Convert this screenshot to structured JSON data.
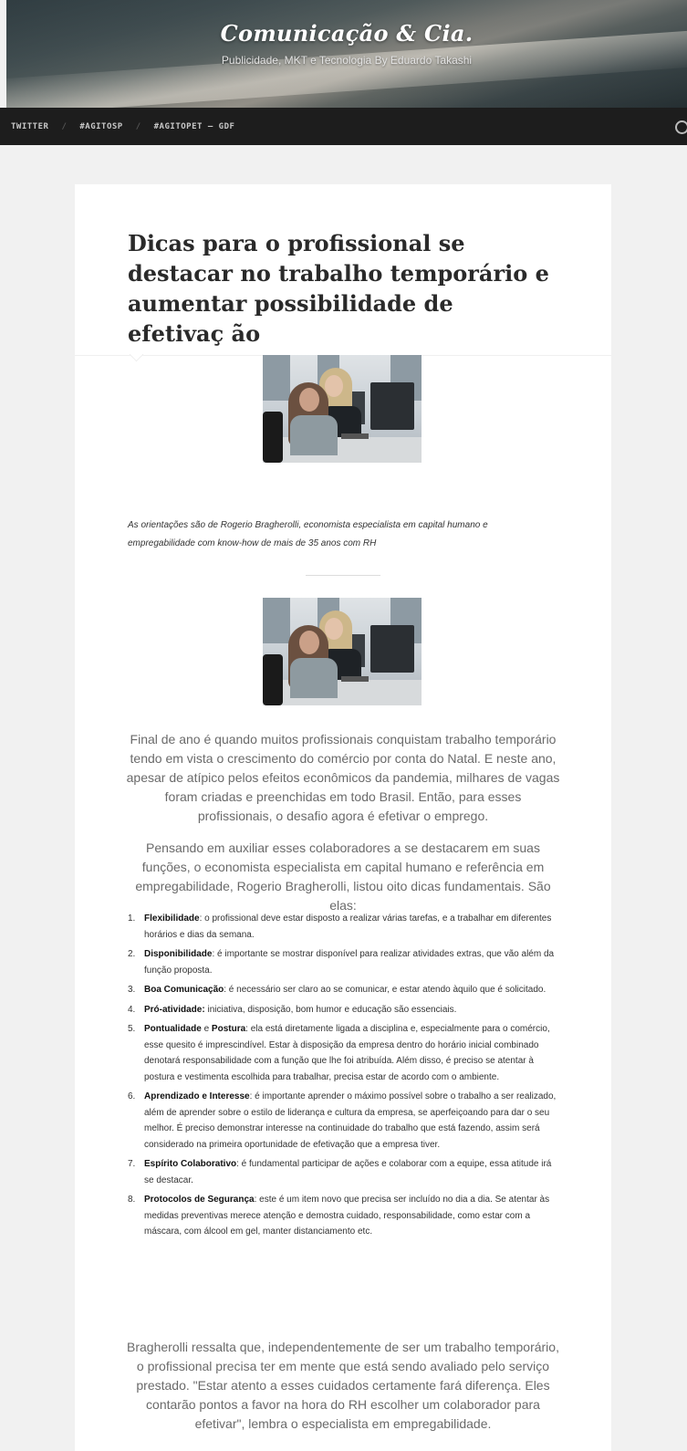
{
  "site": {
    "title": "Comunicação & Cia.",
    "description": "Publicidade, MKT e Tecnologia By Eduardo Takashi"
  },
  "nav": {
    "items": [
      "TWITTER",
      "#AGITOSP",
      "#AGITOPET – GDF"
    ],
    "separator": "/"
  },
  "post": {
    "title": "Dicas para o profissional se destacar no trabalho temporário e aumentar possibilidade de efetivaç ão",
    "caption": "As orientações são de Rogerio Bragherolli, economista especialista em capital humano e empregabilidade com know-how de mais de 35 anos com RH",
    "paragraph1": "Final de ano é quando muitos profissionais conquistam trabalho temporário tendo em vista o crescimento do comércio por conta do Natal. E neste ano, apesar de atípico pelos efeitos econômicos da pandemia, milhares de vagas foram criadas e preenchidas em todo Brasil. Então, para esses profissionais, o desafio agora é efetivar o emprego.",
    "paragraph2": "Pensando em auxiliar esses colaboradores a se destacarem em suas funções, o economista especialista em capital humano e referência em empregabilidade, Rogerio Bragherolli, listou oito dicas fundamentais. São elas:",
    "tips": [
      {
        "num": "1.",
        "term": "Flexibilidade",
        "text": ": o profissional deve estar disposto a realizar várias tarefas, e a trabalhar em diferentes horários e dias da semana."
      },
      {
        "num": "2.",
        "term": "Disponibilidade",
        "text": ": é importante se mostrar disponível para realizar atividades extras, que vão além da função proposta."
      },
      {
        "num": "3.",
        "term": "Boa Comunicação",
        "text": ": é necessário ser claro ao se comunicar, e estar atendo àquilo que é solicitado."
      },
      {
        "num": "4.",
        "term": "Pró-atividade:",
        "text": " iniciativa, disposição, bom humor e educação são essenciais."
      },
      {
        "num": "5.",
        "term": "Pontualidade",
        "term_join": " e ",
        "term2": "Postura",
        "text": ": ela está diretamente ligada a disciplina e, especialmente para o comércio, esse quesito é imprescindível. Estar à disposição da empresa dentro do horário inicial combinado denotará responsabilidade com a função que lhe foi atribuída. Além disso, é preciso se atentar à postura e vestimenta escolhida para trabalhar, precisa estar de acordo com o ambiente."
      },
      {
        "num": "6.",
        "term": "Aprendizado e Interesse",
        "text": ": é importante aprender o máximo possível sobre o trabalho a ser realizado, além de aprender sobre o estilo de liderança e cultura da empresa, se aperfeiçoando para dar o seu melhor. É preciso demonstrar interesse na continuidade do trabalho que está fazendo, assim será considerado na primeira oportunidade de efetivação que a empresa tiver."
      },
      {
        "num": "7.",
        "term": "Espírito Colaborativo",
        "text": ": é fundamental participar de ações e colaborar com a equipe, essa atitude irá se destacar."
      },
      {
        "num": "8.",
        "term": "Protocolos de Segurança",
        "text": ": este é um item novo que precisa ser incluído no dia a dia. Se atentar às medidas preventivas merece atenção e demostra cuidado, responsabilidade, como estar com a máscara, com álcool em gel, manter distanciamento etc."
      }
    ],
    "paragraph3": "Bragherolli ressalta que, independentemente de ser um trabalho temporário, o profissional precisa ter em mente que está sendo avaliado pelo serviço prestado. \"Estar atento a esses cuidados certamente fará diferença. Eles contarão pontos a favor na hora do RH escolher um colaborador para efetivar\", lembra o especialista em empregabilidade."
  }
}
